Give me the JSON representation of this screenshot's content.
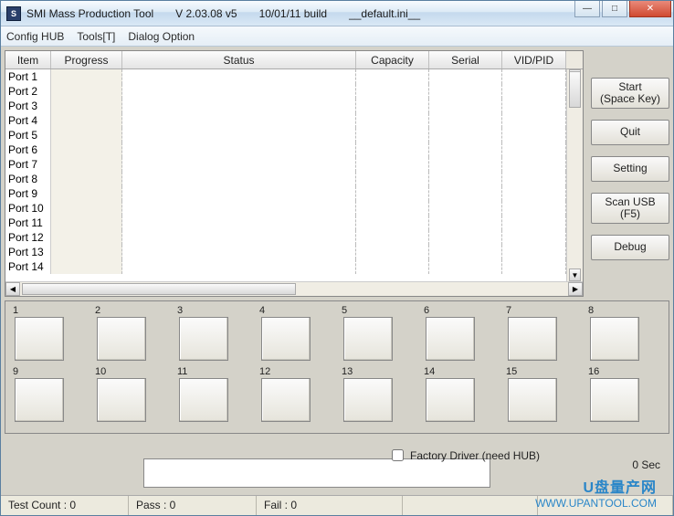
{
  "title": {
    "app_name": "SMI Mass Production Tool",
    "version": "V 2.03.08   v5",
    "build": "10/01/11 build",
    "ini": "__default.ini__"
  },
  "window_controls": {
    "minimize": "—",
    "maximize": "□",
    "close": "✕"
  },
  "menu": {
    "config_hub": "Config HUB",
    "tools": "Tools[T]",
    "dialog_option": "Dialog Option"
  },
  "grid": {
    "headers": {
      "item": "Item",
      "progress": "Progress",
      "status": "Status",
      "capacity": "Capacity",
      "serial": "Serial",
      "vidpid": "VID/PID"
    },
    "rows": [
      {
        "item": "Port 1",
        "progress": "",
        "status": "",
        "capacity": "",
        "serial": "",
        "vidpid": ""
      },
      {
        "item": "Port 2",
        "progress": "",
        "status": "",
        "capacity": "",
        "serial": "",
        "vidpid": ""
      },
      {
        "item": "Port 3",
        "progress": "",
        "status": "",
        "capacity": "",
        "serial": "",
        "vidpid": ""
      },
      {
        "item": "Port 4",
        "progress": "",
        "status": "",
        "capacity": "",
        "serial": "",
        "vidpid": ""
      },
      {
        "item": "Port 5",
        "progress": "",
        "status": "",
        "capacity": "",
        "serial": "",
        "vidpid": ""
      },
      {
        "item": "Port 6",
        "progress": "",
        "status": "",
        "capacity": "",
        "serial": "",
        "vidpid": ""
      },
      {
        "item": "Port 7",
        "progress": "",
        "status": "",
        "capacity": "",
        "serial": "",
        "vidpid": ""
      },
      {
        "item": "Port 8",
        "progress": "",
        "status": "",
        "capacity": "",
        "serial": "",
        "vidpid": ""
      },
      {
        "item": "Port 9",
        "progress": "",
        "status": "",
        "capacity": "",
        "serial": "",
        "vidpid": ""
      },
      {
        "item": "Port 10",
        "progress": "",
        "status": "",
        "capacity": "",
        "serial": "",
        "vidpid": ""
      },
      {
        "item": "Port 11",
        "progress": "",
        "status": "",
        "capacity": "",
        "serial": "",
        "vidpid": ""
      },
      {
        "item": "Port 12",
        "progress": "",
        "status": "",
        "capacity": "",
        "serial": "",
        "vidpid": ""
      },
      {
        "item": "Port 13",
        "progress": "",
        "status": "",
        "capacity": "",
        "serial": "",
        "vidpid": ""
      },
      {
        "item": "Port 14",
        "progress": "",
        "status": "",
        "capacity": "",
        "serial": "",
        "vidpid": ""
      }
    ]
  },
  "buttons": {
    "start_line1": "Start",
    "start_line2": "(Space Key)",
    "quit": "Quit",
    "setting": "Setting",
    "scan_line1": "Scan USB",
    "scan_line2": "(F5)",
    "debug": "Debug"
  },
  "slots": {
    "row1": [
      "1",
      "2",
      "3",
      "4",
      "5",
      "6",
      "7",
      "8"
    ],
    "row2": [
      "9",
      "10",
      "11",
      "12",
      "13",
      "14",
      "15",
      "16"
    ]
  },
  "timer": "0 Sec",
  "checkbox_label": "Factory Driver (need HUB)",
  "statusbar": {
    "test_count": "Test Count : 0",
    "pass": "Pass : 0",
    "fail": "Fail : 0"
  },
  "watermark": {
    "line1": "U盘量产网",
    "line2": "WWW.UPANTOOL.COM"
  }
}
